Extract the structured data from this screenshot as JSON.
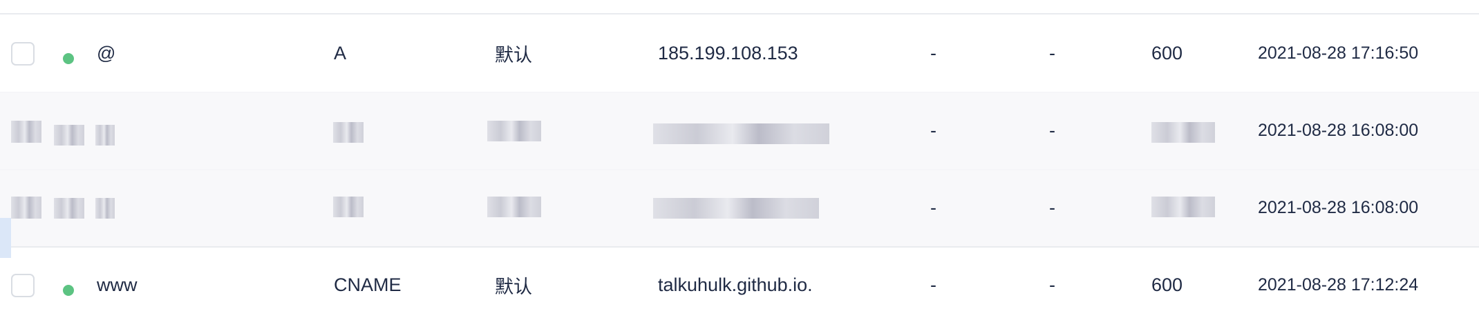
{
  "records": [
    {
      "host": "@",
      "type": "A",
      "line": "默认",
      "value": "185.199.108.153",
      "mx": "-",
      "weight": "-",
      "ttl": "600",
      "updated": "2021-08-28 17:16:50",
      "status": "enabled",
      "status_color": "#5cc382",
      "redacted": false
    },
    {
      "host": "",
      "type": "",
      "line": "",
      "value": "",
      "mx": "-",
      "weight": "-",
      "ttl": "",
      "updated": "2021-08-28 16:08:00",
      "status": "",
      "redacted": true
    },
    {
      "host": "",
      "type": "",
      "line": "",
      "value": "",
      "mx": "-",
      "weight": "-",
      "ttl": "",
      "updated": "2021-08-28 16:08:00",
      "status": "",
      "redacted": true
    },
    {
      "host": "www",
      "type": "CNAME",
      "line": "默认",
      "value": "talkuhulk.github.io.",
      "mx": "-",
      "weight": "-",
      "ttl": "600",
      "updated": "2021-08-28 17:12:24",
      "status": "enabled",
      "status_color": "#5cc382",
      "redacted": false
    }
  ]
}
